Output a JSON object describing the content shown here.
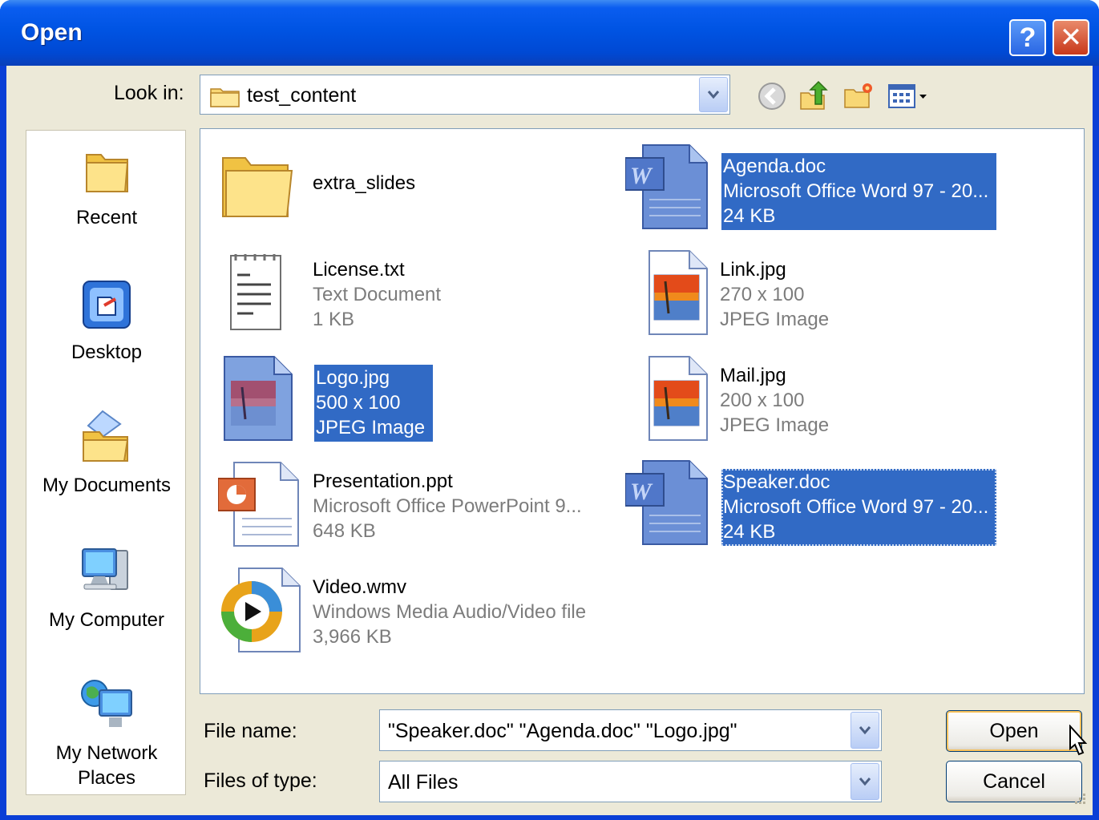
{
  "window": {
    "title": "Open"
  },
  "titlebar_buttons": {
    "help": "?",
    "close": "✕"
  },
  "look_in": {
    "label": "Look in:",
    "value": "test_content"
  },
  "places": [
    {
      "label": "Recent",
      "icon": "recent-folder-icon"
    },
    {
      "label": "Desktop",
      "icon": "desktop-icon"
    },
    {
      "label": "My Documents",
      "icon": "my-documents-icon"
    },
    {
      "label": "My Computer",
      "icon": "my-computer-icon"
    },
    {
      "label": "My Network Places",
      "icon": "network-places-icon"
    }
  ],
  "files": [
    {
      "name": "extra_slides",
      "type": "",
      "size": "",
      "icon": "folder-icon",
      "selected": false
    },
    {
      "name": "Agenda.doc",
      "type": "Microsoft Office Word 97 - 20...",
      "size": "24 KB",
      "icon": "word-doc-icon",
      "selected": true
    },
    {
      "name": "License.txt",
      "type": "Text Document",
      "size": "1 KB",
      "icon": "text-file-icon",
      "selected": false
    },
    {
      "name": "Link.jpg",
      "type": "270 x 100",
      "size": "JPEG Image",
      "icon": "jpeg-image-icon",
      "selected": false
    },
    {
      "name": "Logo.jpg",
      "type": "500 x 100",
      "size": "JPEG Image",
      "icon": "jpeg-image-icon",
      "selected": true
    },
    {
      "name": "Mail.jpg",
      "type": "200 x 100",
      "size": "JPEG Image",
      "icon": "jpeg-image-icon",
      "selected": false
    },
    {
      "name": "Presentation.ppt",
      "type": "Microsoft Office PowerPoint 9...",
      "size": "648 KB",
      "icon": "powerpoint-icon",
      "selected": false
    },
    {
      "name": "Speaker.doc",
      "type": "Microsoft Office Word 97 - 20...",
      "size": "24 KB",
      "icon": "word-doc-icon",
      "selected": true
    },
    {
      "name": "Video.wmv",
      "type": "Windows Media Audio/Video file",
      "size": "3,966 KB",
      "icon": "media-player-icon",
      "selected": false
    }
  ],
  "file_name": {
    "label": "File name:",
    "value": "\"Speaker.doc\" \"Agenda.doc\" \"Logo.jpg\""
  },
  "files_of_type": {
    "label": "Files of type:",
    "value": "All Files"
  },
  "buttons": {
    "open": "Open",
    "cancel": "Cancel"
  }
}
